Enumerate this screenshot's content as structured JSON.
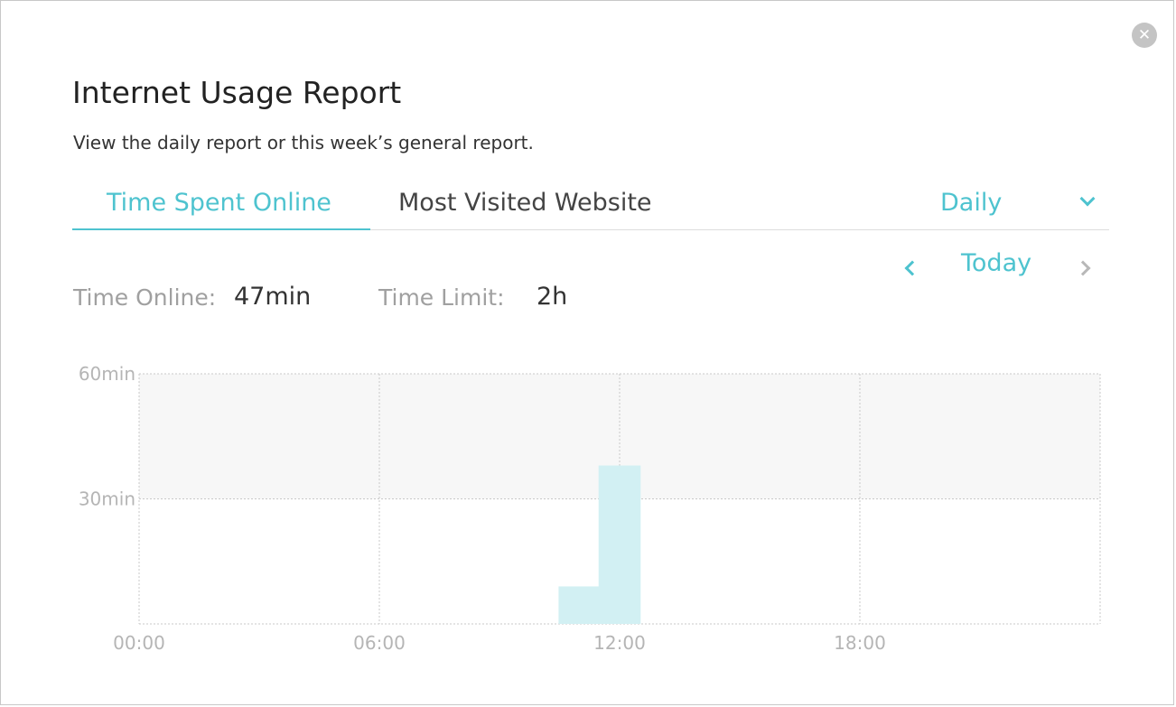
{
  "dialog": {
    "title": "Internet Usage Report",
    "subtitle": "View the daily report or this week’s general report.",
    "close_icon": "close-icon"
  },
  "tabs": [
    {
      "label": "Time Spent Online",
      "active": true
    },
    {
      "label": "Most Visited Website",
      "active": false
    }
  ],
  "period": {
    "selected": "Daily",
    "icon": "chevron-down-icon"
  },
  "date_nav": {
    "label": "Today",
    "prev_icon": "chevron-left-icon",
    "next_icon": "chevron-right-icon"
  },
  "stats": {
    "time_online_label": "Time Online:",
    "time_online_value": "47min",
    "time_limit_label": "Time Limit:",
    "time_limit_value": "2h"
  },
  "colors": {
    "accent": "#4ec3cf",
    "bar": "#d2f0f3",
    "upper_band": "#f7f7f7",
    "grid": "#c8c8c8",
    "tick_text": "#b5b5b5"
  },
  "chart_data": {
    "type": "bar",
    "x_range": [
      0,
      24
    ],
    "x_ticks": [
      {
        "value": 0,
        "label": "00:00"
      },
      {
        "value": 6,
        "label": "06:00"
      },
      {
        "value": 12,
        "label": "12:00"
      },
      {
        "value": 18,
        "label": "18:00"
      }
    ],
    "ylim": [
      0,
      60
    ],
    "y_ticks": [
      {
        "value": 30,
        "label": "30min"
      },
      {
        "value": 60,
        "label": "60min"
      }
    ],
    "bars": [
      {
        "hour": 11,
        "value": 9
      },
      {
        "hour": 12,
        "value": 38
      }
    ],
    "grid": true
  }
}
